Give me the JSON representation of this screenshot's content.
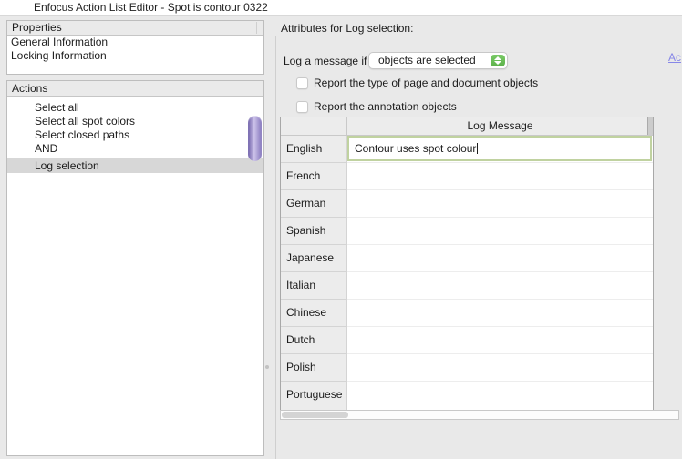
{
  "window": {
    "title": "Enfocus Action List Editor - Spot is contour 0322"
  },
  "left": {
    "properties": {
      "header": "Properties",
      "items": [
        "General Information",
        "Locking Information"
      ]
    },
    "actions": {
      "header": "Actions",
      "items": [
        "Select all",
        "Select all spot colors",
        "Select closed paths",
        "AND",
        "Log selection"
      ],
      "selected_item": "Log selection"
    }
  },
  "right": {
    "title": "Attributes for Log selection:",
    "link_text": "Ac",
    "log_condition": {
      "label": "Log a message if",
      "value": "objects are selected"
    },
    "checkboxes": [
      {
        "label": "Report the type of page and document objects",
        "checked": false
      },
      {
        "label": "Report the annotation objects",
        "checked": false
      }
    ],
    "table": {
      "message_header": "Log Message",
      "rows": [
        {
          "language": "English",
          "message": "Contour uses spot colour"
        },
        {
          "language": "French",
          "message": ""
        },
        {
          "language": "German",
          "message": ""
        },
        {
          "language": "Spanish",
          "message": ""
        },
        {
          "language": "Japanese",
          "message": ""
        },
        {
          "language": "Italian",
          "message": ""
        },
        {
          "language": "Chinese",
          "message": ""
        },
        {
          "language": "Dutch",
          "message": ""
        },
        {
          "language": "Polish",
          "message": ""
        },
        {
          "language": "Portuguese",
          "message": ""
        }
      ]
    }
  },
  "colors": {
    "background": "#e9e9e9",
    "accent_green": "#67bf55",
    "scrollbar_purple": "#8577bd",
    "link": "#8787e8",
    "focused_field_border": "#c0d2a0",
    "selected_row": "#d7d7d7"
  }
}
